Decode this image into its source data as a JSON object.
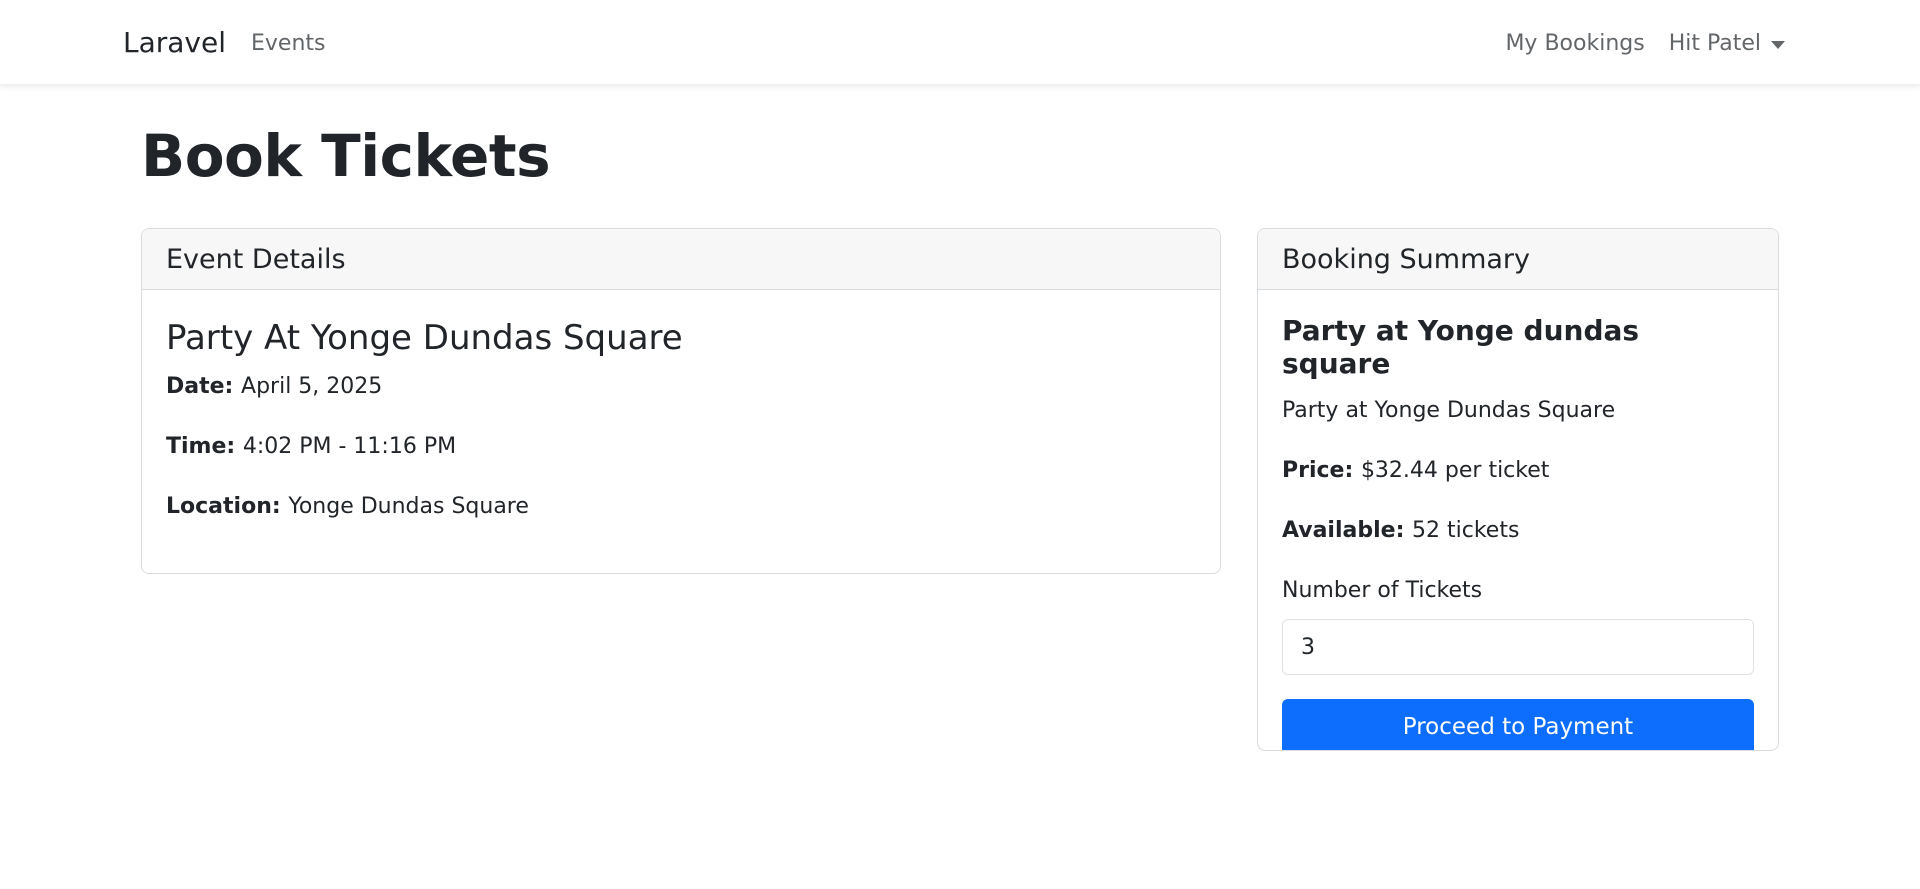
{
  "navbar": {
    "brand": "Laravel",
    "links": {
      "events": "Events",
      "my_bookings": "My Bookings"
    },
    "user_name": "Hit Patel",
    "user_caret_icon": "caret-down-icon"
  },
  "page": {
    "title": "Book Tickets"
  },
  "event_card": {
    "header": "Event Details",
    "title": "Party At Yonge Dundas Square",
    "date_label": "Date:",
    "date_value": "April 5, 2025",
    "time_label": "Time:",
    "time_value": "4:02 PM - 11:16 PM",
    "location_label": "Location:",
    "location_value": "Yonge Dundas Square"
  },
  "summary_card": {
    "header": "Booking Summary",
    "title": "Party at Yonge dundas square",
    "description": "Party at Yonge Dundas Square",
    "price_label": "Price:",
    "price_value": "$32.44 per ticket",
    "available_label": "Available:",
    "available_value": "52 tickets",
    "tickets_label": "Number of Tickets",
    "tickets_value": "3",
    "submit_label": "Proceed to Payment",
    "accent_color": "#0d6efd"
  }
}
